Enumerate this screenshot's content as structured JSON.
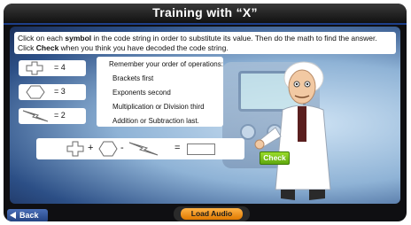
{
  "header": {
    "title": "Training with “X”"
  },
  "instructions": {
    "part1": "Click on each ",
    "bold1": "symbol",
    "part2": " in the code string in order to substitute its value. Then do the math to find the answer. Click ",
    "bold2": "Check",
    "part3": " when you think you have decoded the code string."
  },
  "symbols": [
    {
      "icon": "cross-shape-icon",
      "value": "= 4"
    },
    {
      "icon": "hexagon-shape-icon",
      "value": "= 3"
    },
    {
      "icon": "lightning-shape-icon",
      "value": "= 2"
    }
  ],
  "order_of_operations": {
    "heading": "Remember your order of operations:",
    "steps": [
      "Brackets first",
      "Exponents second",
      "Multiplication or Division third",
      "Addition or Subtraction last."
    ]
  },
  "equation": {
    "op1": "+",
    "op2": "-",
    "equals": "=",
    "answer_value": ""
  },
  "buttons": {
    "check": "Check",
    "back": "Back",
    "load_audio": "Load Audio"
  },
  "colors": {
    "title_bar": "#1a1a1a",
    "check_green": "#6fbf1a",
    "audio_orange": "#f29a1c",
    "back_blue": "#2d4e93"
  }
}
